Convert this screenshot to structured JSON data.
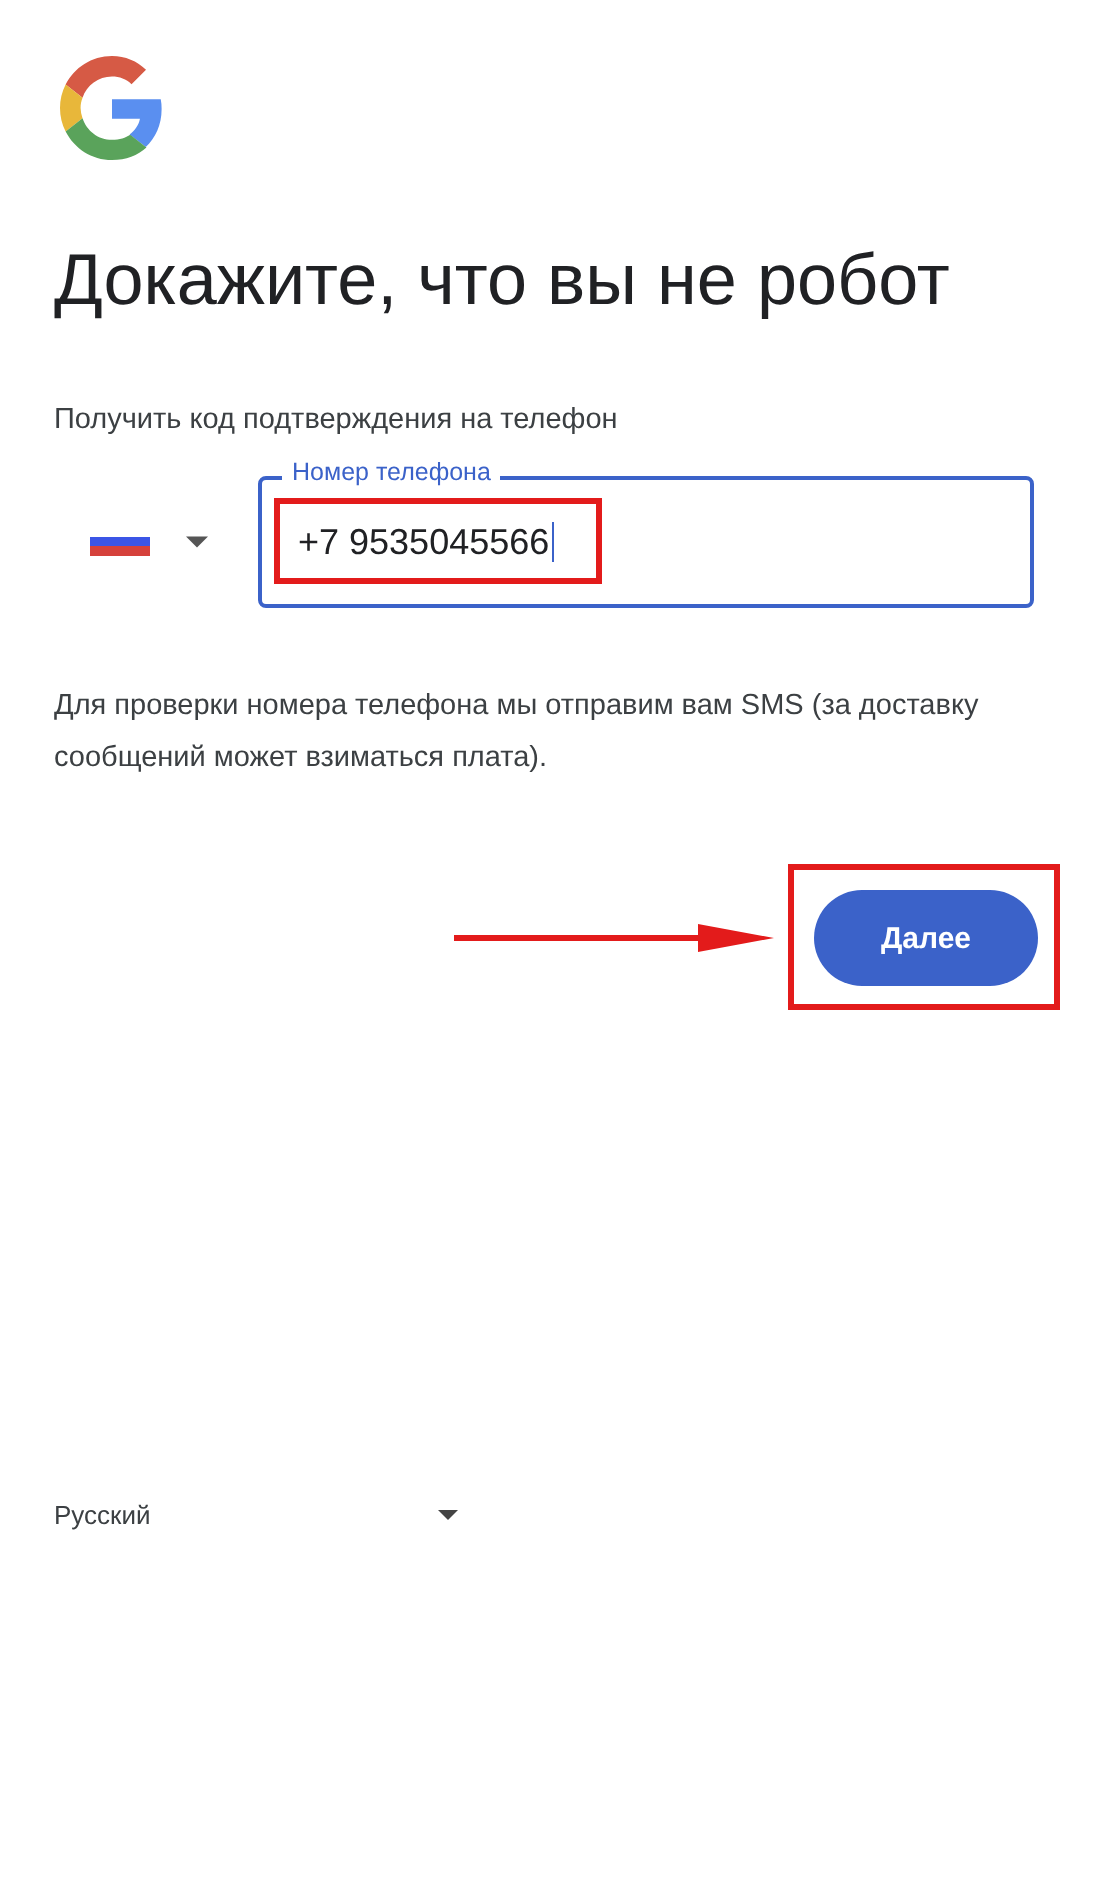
{
  "title": "Докажите, что вы не робот",
  "subtitle": "Получить код подтверждения на телефон",
  "phone_field": {
    "label": "Номер телефона",
    "value": "+7 9535045566"
  },
  "notice": "Для проверки номера телефона мы отправим вам SMS (за доставку сообщений может взиматься плата).",
  "next_button": "Далее",
  "language": "Русский"
}
